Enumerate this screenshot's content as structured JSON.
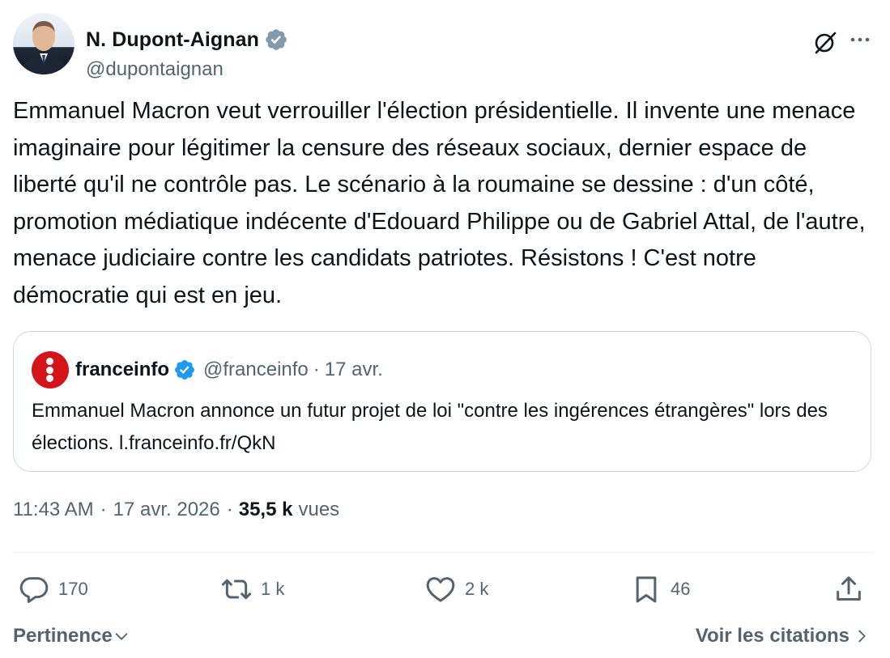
{
  "author": {
    "display_name": "N. Dupont-Aignan",
    "handle": "@dupontaignan",
    "verified": true
  },
  "tweet": {
    "text": "Emmanuel Macron veut verrouiller l'élection présidentielle. Il invente une menace imaginaire pour légitimer la censure des réseaux sociaux, dernier espace de liberté qu'il ne contrôle pas. Le scénario à la roumaine se dessine : d'un côté, promotion médiatique indécente d'Edouard Philippe ou de Gabriel Attal, de l'autre, menace judiciaire contre les candidats patriotes. Résistons ! C'est notre démocratie qui est en jeu."
  },
  "quote": {
    "name": "franceinfo",
    "handle": "@franceinfo",
    "separator": "·",
    "date": "17 avr.",
    "text": "Emmanuel Macron annonce un futur projet de loi \"contre les ingérences étrangères\" lors des élections. l.franceinfo.fr/QkN"
  },
  "meta": {
    "time": "11:43 AM",
    "sep1": "·",
    "date": "17 avr. 2026",
    "sep2": "·",
    "views_count": "35,5 k",
    "views_label": "vues"
  },
  "actions": {
    "replies": "170",
    "reposts": "1 k",
    "likes": "2 k",
    "bookmarks": "46"
  },
  "footer": {
    "sort_label": "Pertinence",
    "quotes_label": "Voir les citations"
  },
  "colors": {
    "text_primary": "#0f1419",
    "text_secondary": "#536471",
    "verified_blue": "#1d9bf0",
    "verified_gray": "#829aab",
    "franceinfo_red": "#d3151b",
    "border": "#cfd9de"
  },
  "icons": [
    "verified-badge-icon",
    "grok-icon",
    "more-icon",
    "reply-icon",
    "repost-icon",
    "like-icon",
    "bookmark-icon",
    "share-icon",
    "chevron-down-icon",
    "chevron-right-icon"
  ]
}
